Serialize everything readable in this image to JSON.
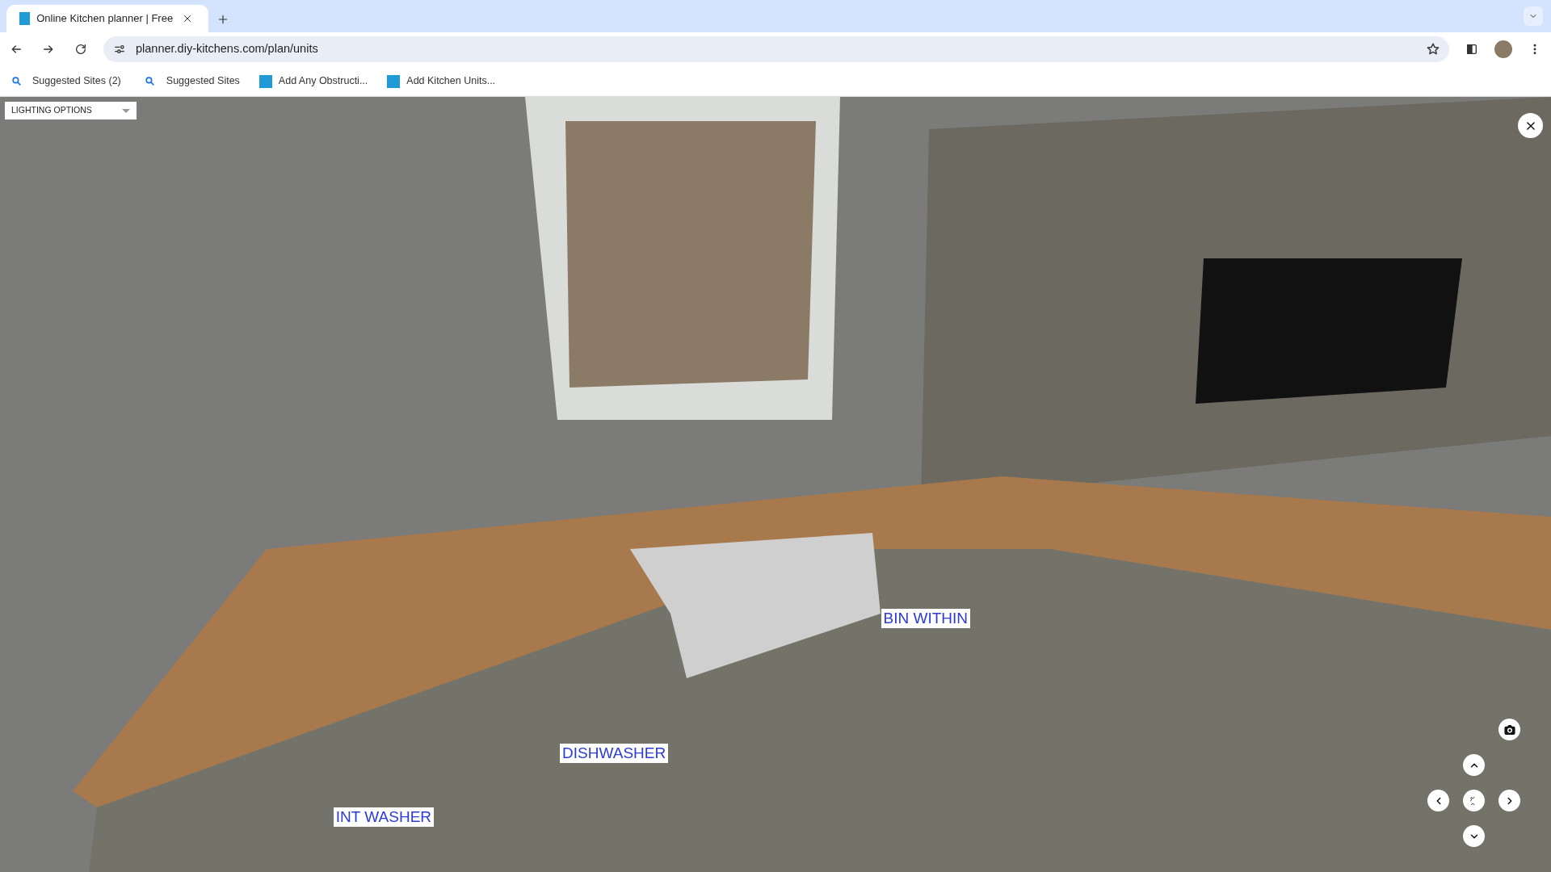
{
  "browser": {
    "tabs": [
      {
        "title": "Online Kitchen planner | Free",
        "selected": true
      }
    ],
    "url": "planner.diy-kitchens.com/plan/units",
    "bookmarks": [
      {
        "kind": "search",
        "label": "Suggested Sites (2)"
      },
      {
        "kind": "search",
        "label": "Suggested Sites"
      },
      {
        "kind": "site",
        "label": "Add Any Obstructi..."
      },
      {
        "kind": "site",
        "label": "Add Kitchen Units..."
      }
    ]
  },
  "planner": {
    "lighting_dropdown": "LIGHTING OPTIONS",
    "unit_labels": [
      "BIN WITHIN",
      "DISHWASHER",
      "INT WASHER"
    ]
  }
}
